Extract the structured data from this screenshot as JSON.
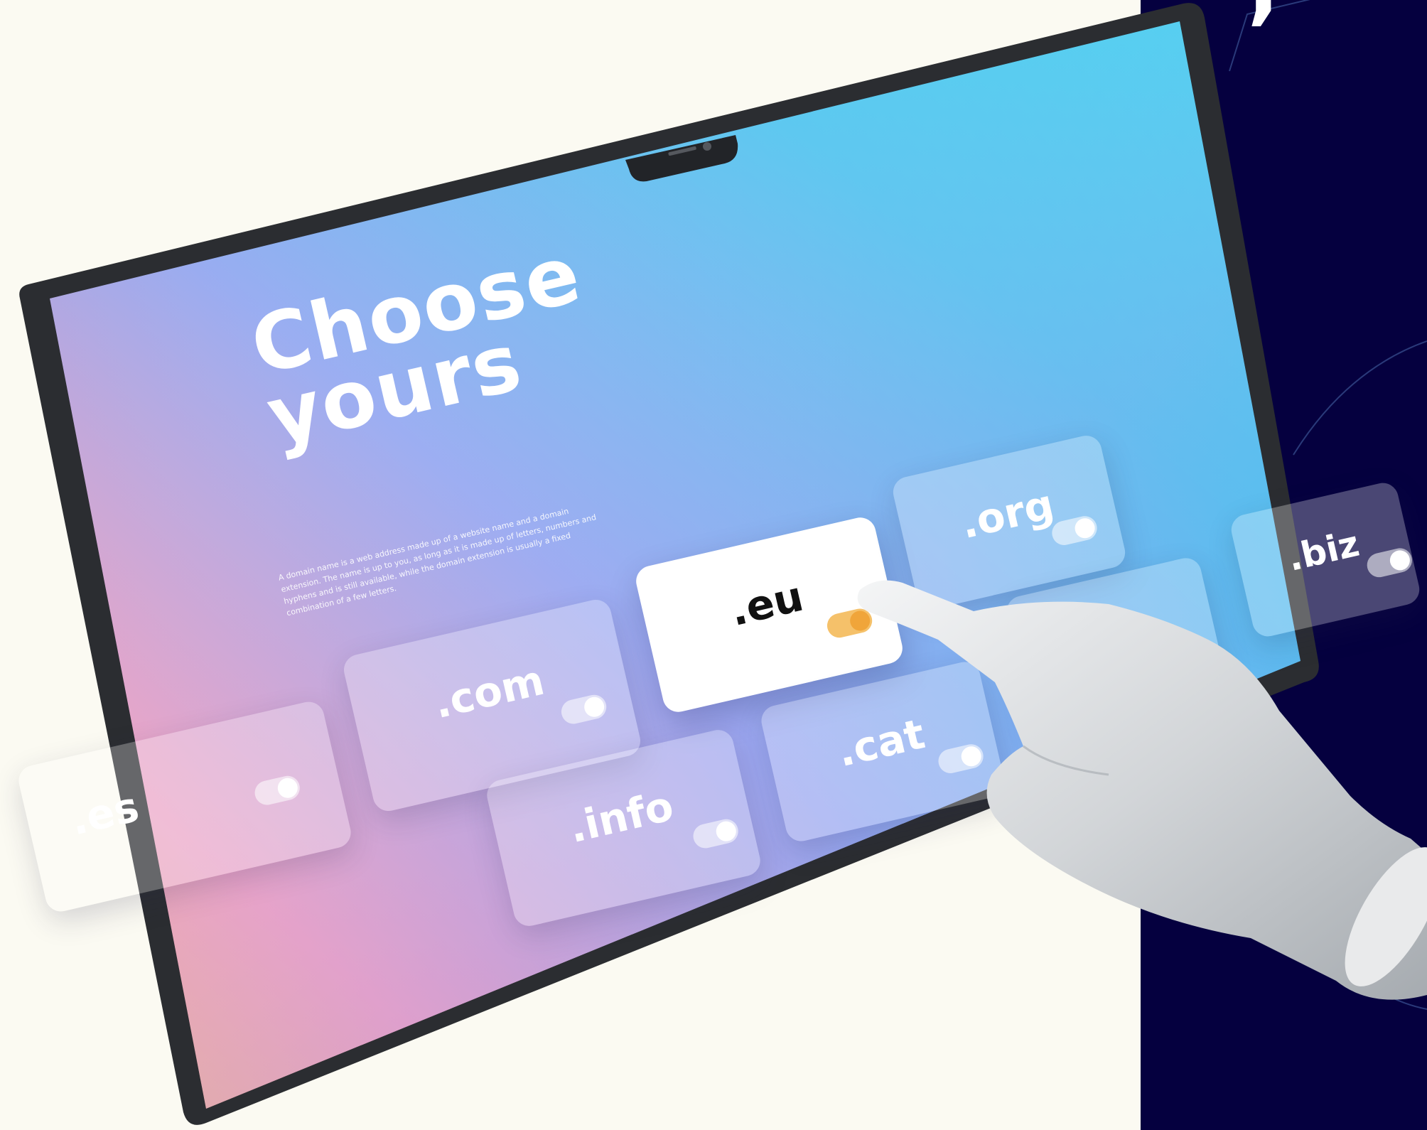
{
  "headline": {
    "line1": "Choose",
    "line2": "yours"
  },
  "description": "A domain name is a web address made up of a website name and a domain extension. The name is up to you, as long as it is made up of letters, numbers and hyphens and is still available, while the domain extension is usually a fixed combination of a few letters.",
  "tiles": [
    {
      "label": ".es",
      "selected": false
    },
    {
      "label": ".com",
      "selected": false
    },
    {
      "label": ".eu",
      "selected": true
    },
    {
      "label": ".org",
      "selected": false
    },
    {
      "label": ".info",
      "selected": false
    },
    {
      "label": ".cat",
      "selected": false
    },
    {
      "label": ".biz",
      "selected": false
    }
  ],
  "colors": {
    "background": "#fbfaf2",
    "navy_panel": "#05003f",
    "toggle_on": "#f0a53a",
    "screen_cyan": "#38d9f0",
    "screen_pink": "#f49ab8"
  }
}
